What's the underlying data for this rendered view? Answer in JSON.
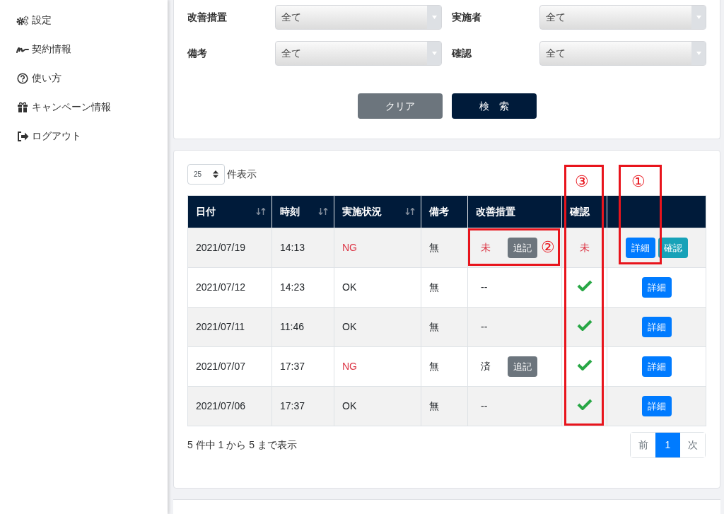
{
  "sidebar": {
    "items": [
      {
        "label": "設定"
      },
      {
        "label": "契約情報"
      },
      {
        "label": "使い方"
      },
      {
        "label": "キャンペーン情報"
      },
      {
        "label": "ログアウト"
      }
    ]
  },
  "filters": [
    {
      "label": "改善措置",
      "value": "全て"
    },
    {
      "label": "実施者",
      "value": "全て"
    },
    {
      "label": "備考",
      "value": "全て"
    },
    {
      "label": "確認",
      "value": "全て"
    }
  ],
  "filter_buttons": [
    {
      "kind": "secondary",
      "label": "クリア"
    },
    {
      "kind": "primary",
      "label": "検　索"
    }
  ],
  "page_size": {
    "value": "25",
    "suffix": "件表示"
  },
  "table": {
    "columns": [
      {
        "label": "日付",
        "sortable": true
      },
      {
        "label": "時刻",
        "sortable": true
      },
      {
        "label": "実施状況",
        "sortable": true
      },
      {
        "label": "備考",
        "sortable": false
      },
      {
        "label": "改善措置",
        "sortable": false
      },
      {
        "label": "確認",
        "sortable": false
      },
      {
        "sortable": false
      }
    ],
    "rows": [
      {
        "date": "2021/07/19",
        "time": "14:13",
        "status": "NG",
        "ng": true,
        "note": "無",
        "measure": "未",
        "measure_pending": true,
        "add_button": "追記",
        "confirmed": false,
        "confirm_text": "未",
        "buttons": [
          {
            "kind": "detail",
            "label": "詳細"
          },
          {
            "kind": "confirm",
            "label": "確認"
          }
        ]
      },
      {
        "date": "2021/07/12",
        "time": "14:23",
        "status": "OK",
        "ng": false,
        "note": "無",
        "measure": "--",
        "measure_pending": false,
        "confirmed": true,
        "buttons": [
          {
            "kind": "detail",
            "label": "詳細"
          }
        ]
      },
      {
        "date": "2021/07/11",
        "time": "11:46",
        "status": "OK",
        "ng": false,
        "note": "無",
        "measure": "--",
        "measure_pending": false,
        "confirmed": true,
        "buttons": [
          {
            "kind": "detail",
            "label": "詳細"
          }
        ]
      },
      {
        "date": "2021/07/07",
        "time": "17:37",
        "status": "NG",
        "ng": true,
        "note": "無",
        "measure": "済",
        "measure_pending": false,
        "add_button": "追記",
        "confirmed": true,
        "buttons": [
          {
            "kind": "detail",
            "label": "詳細"
          }
        ]
      },
      {
        "date": "2021/07/06",
        "time": "17:37",
        "status": "OK",
        "ng": false,
        "note": "無",
        "measure": "--",
        "measure_pending": false,
        "confirmed": true,
        "buttons": [
          {
            "kind": "detail",
            "label": "詳細"
          }
        ]
      }
    ]
  },
  "summary": "5 件中 1 から 5 まで表示",
  "pagination": [
    {
      "label": "前",
      "selected": false
    },
    {
      "label": "1",
      "selected": true
    },
    {
      "label": "次",
      "selected": false
    }
  ],
  "annotations": [
    {
      "label": "①"
    },
    {
      "label": "②"
    },
    {
      "label": "③"
    }
  ]
}
